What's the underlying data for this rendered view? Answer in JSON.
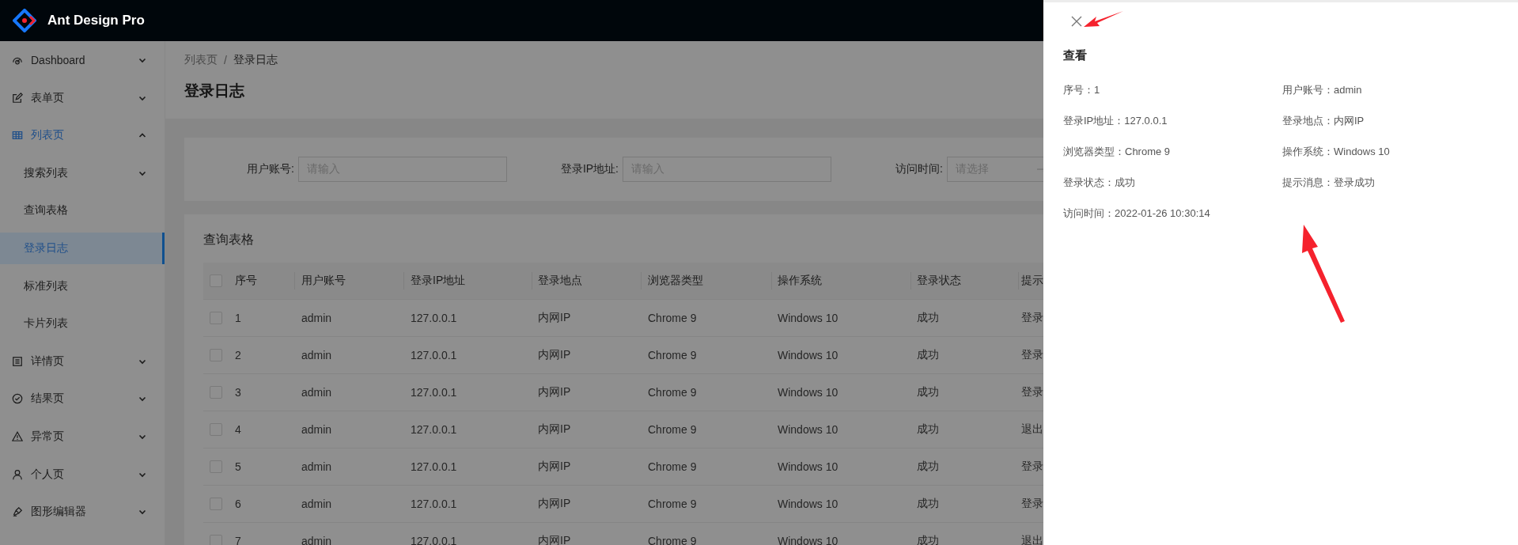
{
  "app": {
    "title": "Ant Design Pro"
  },
  "sidebar": {
    "items": [
      {
        "label": "Dashboard",
        "expanded": false,
        "selected": false
      },
      {
        "label": "表单页",
        "expanded": false,
        "selected": false
      },
      {
        "label": "列表页",
        "expanded": true,
        "selected": true,
        "children": [
          {
            "label": "搜索列表",
            "kind": "submenu",
            "expanded": false,
            "selected": false
          },
          {
            "label": "查询表格",
            "kind": "item",
            "selected": false
          },
          {
            "label": "登录日志",
            "kind": "item",
            "selected": true
          },
          {
            "label": "标准列表",
            "kind": "item",
            "selected": false
          },
          {
            "label": "卡片列表",
            "kind": "item",
            "selected": false
          }
        ]
      },
      {
        "label": "详情页",
        "expanded": false,
        "selected": false
      },
      {
        "label": "结果页",
        "expanded": false,
        "selected": false
      },
      {
        "label": "异常页",
        "expanded": false,
        "selected": false
      },
      {
        "label": "个人页",
        "expanded": false,
        "selected": false
      },
      {
        "label": "图形编辑器",
        "expanded": false,
        "selected": false
      }
    ]
  },
  "breadcrumb": {
    "separator": "/",
    "items": [
      "列表页",
      "登录日志"
    ]
  },
  "page_title": "登录日志",
  "filters": [
    {
      "label": "用户账号:",
      "placeholder": "请输入",
      "kind": "text"
    },
    {
      "label": "登录IP地址:",
      "placeholder": "请输入",
      "kind": "text"
    },
    {
      "label": "访问时间:",
      "placeholder": "请选择",
      "kind": "range"
    }
  ],
  "table": {
    "title": "查询表格",
    "header_checked": false,
    "columns": [
      "序号",
      "用户账号",
      "登录IP地址",
      "登录地点",
      "浏览器类型",
      "操作系统",
      "登录状态",
      "提示"
    ],
    "rows": [
      {
        "checked": false,
        "cells": [
          "1",
          "admin",
          "127.0.0.1",
          "内网IP",
          "Chrome 9",
          "Windows 10",
          "成功",
          "登录"
        ]
      },
      {
        "checked": false,
        "cells": [
          "2",
          "admin",
          "127.0.0.1",
          "内网IP",
          "Chrome 9",
          "Windows 10",
          "成功",
          "登录"
        ]
      },
      {
        "checked": false,
        "cells": [
          "3",
          "admin",
          "127.0.0.1",
          "内网IP",
          "Chrome 9",
          "Windows 10",
          "成功",
          "登录"
        ]
      },
      {
        "checked": false,
        "cells": [
          "4",
          "admin",
          "127.0.0.1",
          "内网IP",
          "Chrome 9",
          "Windows 10",
          "成功",
          "退出"
        ]
      },
      {
        "checked": false,
        "cells": [
          "5",
          "admin",
          "127.0.0.1",
          "内网IP",
          "Chrome 9",
          "Windows 10",
          "成功",
          "登录"
        ]
      },
      {
        "checked": false,
        "cells": [
          "6",
          "admin",
          "127.0.0.1",
          "内网IP",
          "Chrome 9",
          "Windows 10",
          "成功",
          "登录"
        ]
      },
      {
        "checked": false,
        "cells": [
          "7",
          "admin",
          "127.0.0.1",
          "内网IP",
          "Chrome 9",
          "Windows 10",
          "成功",
          "退出"
        ]
      }
    ]
  },
  "drawer": {
    "title": "查看",
    "fields": [
      {
        "label": "序号：",
        "value": "1"
      },
      {
        "label": "用户账号：",
        "value": "admin"
      },
      {
        "label": "登录IP地址：",
        "value": "127.0.0.1"
      },
      {
        "label": "登录地点：",
        "value": "内网IP"
      },
      {
        "label": "浏览器类型：",
        "value": "Chrome 9"
      },
      {
        "label": "操作系统：",
        "value": "Windows 10"
      },
      {
        "label": "登录状态：",
        "value": "成功"
      },
      {
        "label": "提示消息：",
        "value": "登录成功"
      },
      {
        "label": "访问时间：",
        "value": "2022-01-26 10:30:14"
      }
    ]
  }
}
